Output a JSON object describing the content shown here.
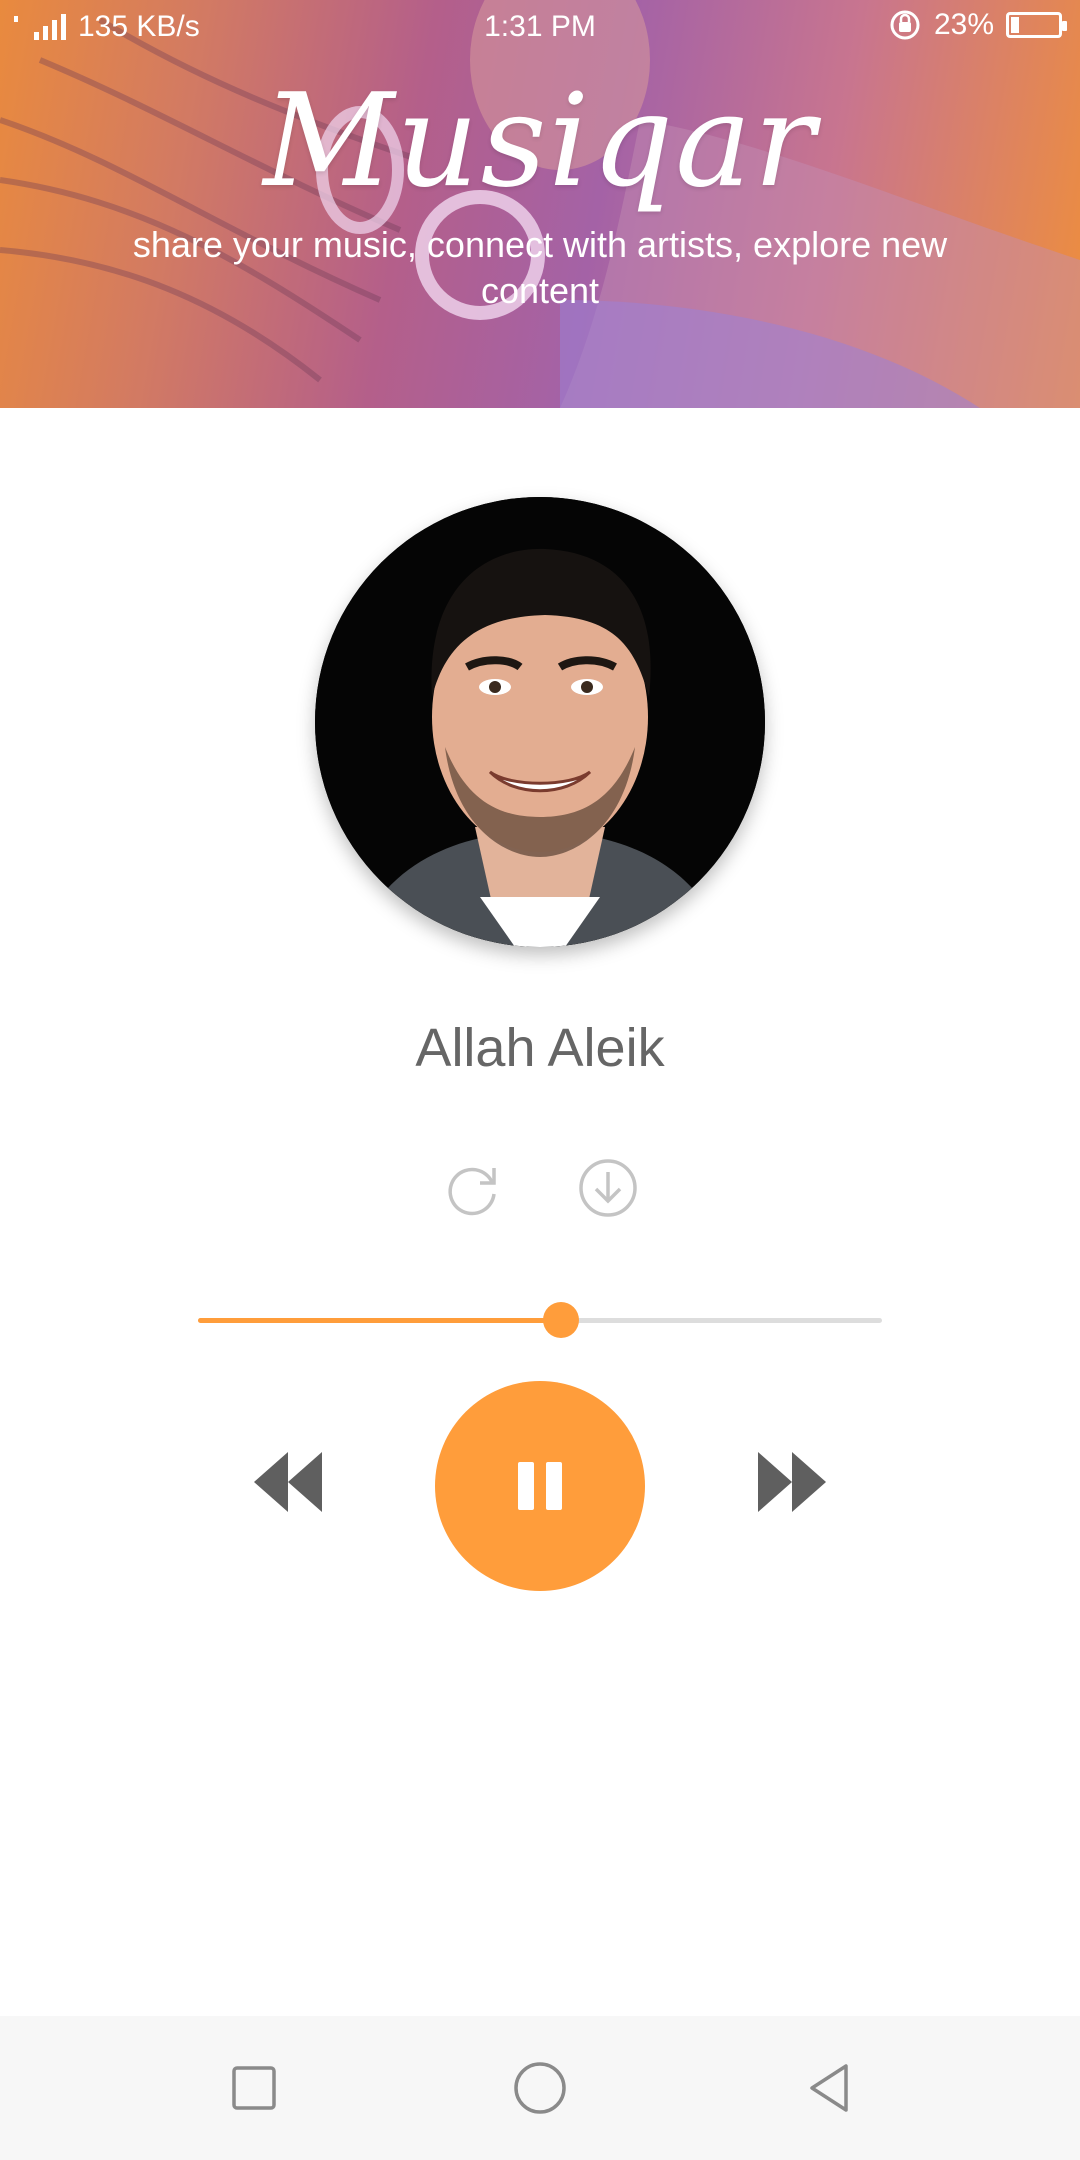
{
  "status_bar": {
    "network_speed": "135 KB/s",
    "time": "1:31 PM",
    "battery_percent": "23%",
    "battery_level": 0.23
  },
  "header": {
    "app_name": "Musiqar",
    "tagline": "share your music, connect with artists, explore new content"
  },
  "player": {
    "track_title": "Allah Aleik",
    "progress": 0.53,
    "accent_color": "#ff9d3b",
    "icons": {
      "repeat": "repeat-icon",
      "download": "download-icon",
      "rewind": "rewind-icon",
      "pause": "pause-icon",
      "forward": "fast-forward-icon"
    }
  },
  "nav_bar": {
    "icons": [
      "recents-square-icon",
      "home-circle-icon",
      "back-triangle-icon"
    ]
  }
}
